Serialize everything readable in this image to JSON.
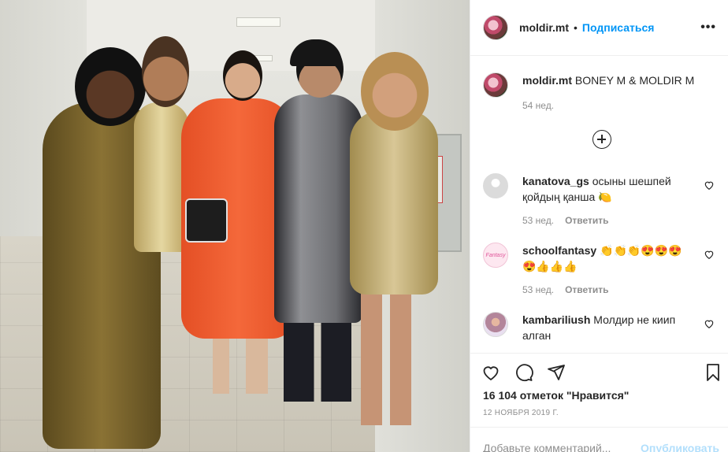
{
  "post": {
    "author": "moldir.mt",
    "follow_label": "Подписаться",
    "dot": "•",
    "more": "•••",
    "caption_user": "moldir.mt",
    "caption_text": "BONEY M & MOLDIR M",
    "caption_time": "54 нед."
  },
  "comments": [
    {
      "user": "kanatova_gs",
      "text": "осыны шешпей қойдың қанша 🍋",
      "time": "53 нед.",
      "reply": "Ответить"
    },
    {
      "user": "schoolfantasy",
      "text": "👏👏👏😍😍😍😍👍👍👍",
      "time": "53 нед.",
      "reply": "Ответить",
      "avatar_text": "Fantasy"
    },
    {
      "user": "kambariliush",
      "text": "Молдир не киип алган"
    }
  ],
  "stats": {
    "likes": "16 104 отметок \"Нравится\"",
    "date": "12 НОЯБРЯ 2019 Г."
  },
  "input": {
    "placeholder": "Добавьте комментарий...",
    "publish": "Опубликовать"
  },
  "icons": [
    "heart-icon",
    "comment-icon",
    "share-icon",
    "bookmark-icon",
    "more-icon",
    "plus-circle-icon"
  ],
  "colors": {
    "link": "#0095f6",
    "muted": "#8e8e8e",
    "publish_disabled": "#b2dffc"
  }
}
